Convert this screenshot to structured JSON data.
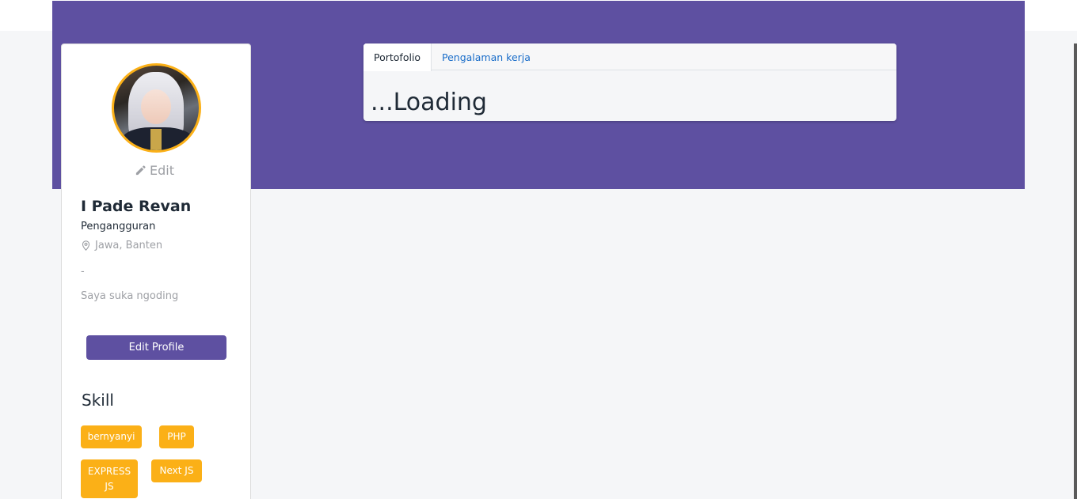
{
  "profile": {
    "edit_photo_label": "Edit",
    "name": "I Pade Revan",
    "job": "Pengangguran",
    "location": "Jawa, Banten",
    "dash": "-",
    "bio": "Saya suka ngoding",
    "edit_profile_label": "Edit Profile"
  },
  "skills": {
    "title": "Skill",
    "items": [
      "bernyanyi",
      "PHP",
      "EXPRESS JS",
      "Next JS"
    ]
  },
  "tabs": {
    "items": [
      {
        "label": "Portofolio",
        "active": true
      },
      {
        "label": "Pengalaman kerja",
        "active": false
      }
    ],
    "content": "...Loading"
  },
  "colors": {
    "primary": "#5e50a1",
    "accent": "#fbb017",
    "link": "#1a6dc9"
  },
  "icons": {
    "edit": "pencil-icon",
    "location": "map-pin-icon"
  }
}
